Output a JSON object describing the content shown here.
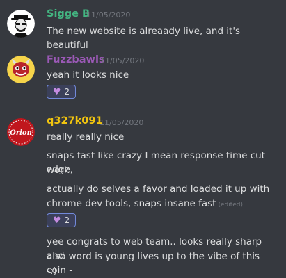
{
  "messages": [
    {
      "author": "Sigge B",
      "author_color": "#43b581",
      "timestamp": "11/05/2020",
      "lines": [
        "The new website is alreaady live, and it's beautiful"
      ]
    },
    {
      "author": "Fuzzbawls",
      "author_color": "#9b59b6",
      "timestamp": "11/05/2020",
      "lines": [
        "yeah it looks nice"
      ],
      "reaction": {
        "emoji": "💜",
        "count": "2"
      }
    },
    {
      "author": "q327k091",
      "author_color": "#f1c40f",
      "timestamp": "11/05/2020",
      "avatar_text": "Orion",
      "lines": [
        "really really nice",
        "snaps fast like crazy I mean response time cut edge,",
        "work",
        "actually do selves a favor and loaded it up with",
        "chrome dev tools, snaps insane fast",
        "yee congrats to web team.. looks really sharp and",
        "also word is young lives up to the vibe of this coin -",
        "-:)"
      ],
      "edited_label": "(edited)",
      "reaction": {
        "emoji": "💜",
        "count": "2"
      }
    }
  ]
}
